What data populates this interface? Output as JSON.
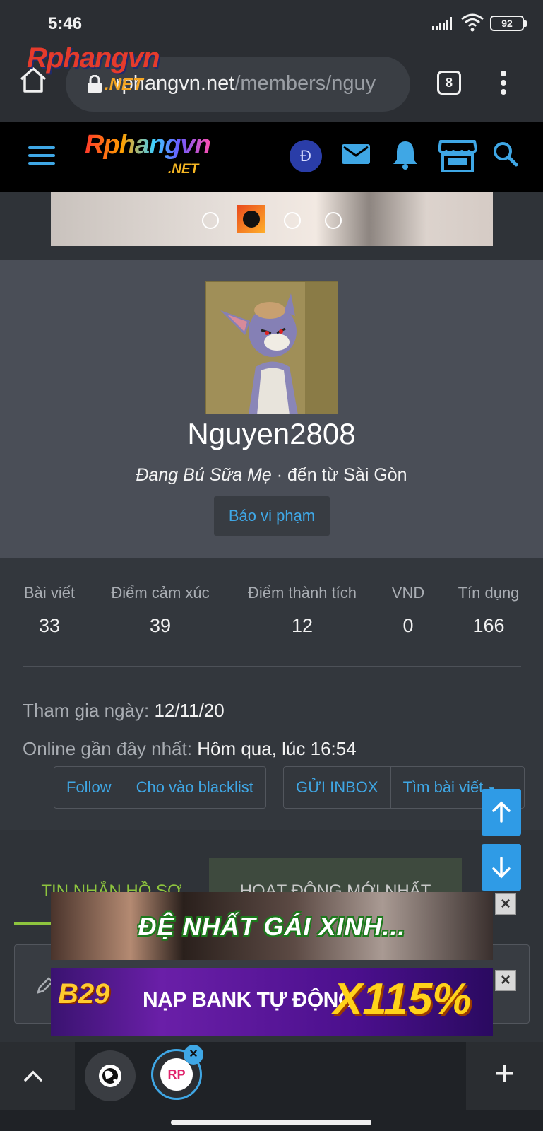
{
  "status_bar": {
    "time": "5:46",
    "battery": "92"
  },
  "browser": {
    "url_host": "rphangvn.net",
    "url_path": "/members/nguy",
    "tab_count": "8",
    "watermark": "Rphangvn",
    "watermark_net": ".NET"
  },
  "site_header": {
    "logo": "Rphangvn",
    "logo_net": ".NET",
    "currency_symbol": "Đ",
    "icons": [
      "menu-icon",
      "currency-icon",
      "mail-icon",
      "bell-icon",
      "store-icon",
      "search-icon"
    ],
    "accent_color": "#3fa7e5"
  },
  "carousel": {
    "dot_count": 4,
    "active_index": 2
  },
  "profile": {
    "username": "Nguyen2808",
    "title": "Đang Bú Sữa Mẹ",
    "location_text": " · đến từ Sài Gòn",
    "report_label": "Báo vi phạm"
  },
  "stats": [
    {
      "label": "Bài viết",
      "value": "33"
    },
    {
      "label": "Điểm cảm xúc",
      "value": "39"
    },
    {
      "label": "Điểm thành tích",
      "value": "12"
    },
    {
      "label": "VND",
      "value": "0"
    },
    {
      "label": "Tín dụng",
      "value": "166"
    }
  ],
  "joined": {
    "label": "Tham gia ngày:",
    "value": "12/11/20"
  },
  "last_seen": {
    "label": "Online gần đây nhất:",
    "value": "Hôm qua, lúc 16:54"
  },
  "actions": {
    "follow": "Follow",
    "blacklist": "Cho vào blacklist",
    "inbox": "GỬI INBOX",
    "find_posts": "Tìm bài viết"
  },
  "tabs": [
    {
      "label": "TIN NHẮN HỒ SƠ",
      "active": true
    },
    {
      "label": "HOẠT ĐỘNG MỚI NHẤT",
      "active": false
    }
  ],
  "ads": {
    "ad1_text": "ĐỆ NHẤT GÁI XINH...",
    "ad2_logo": "B29",
    "ad2_text": "NẠP BANK TỰ ĐỘNG",
    "ad2_big": "X115%"
  },
  "bottom_nav": {
    "rp_tab_label": "RP"
  }
}
